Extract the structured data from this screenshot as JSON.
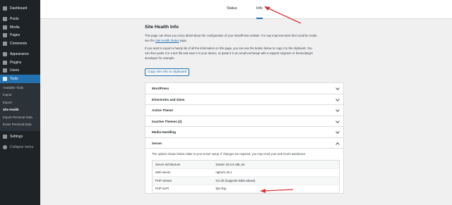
{
  "sidebar": {
    "items": [
      {
        "label": "Dashboard",
        "icon": "dashboard-icon"
      },
      {
        "label": "Posts",
        "icon": "pin-icon"
      },
      {
        "label": "Media",
        "icon": "media-icon"
      },
      {
        "label": "Pages",
        "icon": "page-icon"
      },
      {
        "label": "Comments",
        "icon": "comment-icon"
      },
      {
        "label": "Appearance",
        "icon": "brush-icon"
      },
      {
        "label": "Plugins",
        "icon": "plugin-icon"
      },
      {
        "label": "Users",
        "icon": "users-icon"
      },
      {
        "label": "Tools",
        "icon": "wrench-icon"
      }
    ],
    "submenu": [
      "Available Tools",
      "Import",
      "Export",
      "Site Health",
      "Export Personal Data",
      "Erase Personal Data"
    ],
    "after": [
      {
        "label": "Settings",
        "icon": "settings-icon"
      },
      {
        "label": "Collapse menu",
        "icon": "collapse-icon"
      }
    ]
  },
  "header": {
    "tabs": [
      "Status",
      "Info"
    ],
    "active_tab": "Info"
  },
  "main": {
    "title": "Site Health Info",
    "desc1": "This page can show you every detail about the configuration of your WordPress website. For any improvements that could be made,",
    "desc1b_pre": "see the ",
    "desc1b_link": "Site Health Status",
    "desc1b_post": " page.",
    "desc2a": "If you want to export a handy list of all the information on this page, you can use the button below to copy it to the clipboard. You",
    "desc2b": "can then paste it in a text file and save it to your device, or paste it in an email exchange with a support engineer or theme/plugin",
    "desc2c": "developer for example.",
    "copy_button": "Copy site info to clipboard"
  },
  "accordion": {
    "sections": [
      "WordPress",
      "Directories and Sizes",
      "Active Theme",
      "Inactive Themes (2)",
      "Media Handling",
      "Server"
    ],
    "server_desc": "The options shown below relate to your server setup. If changes are required, you may need your web host's assistance.",
    "rows": [
      {
        "key": "Server architecture",
        "value": "Darwin 19.6.0 x86_64"
      },
      {
        "key": "Web server",
        "value": "nginx/1.19.1"
      },
      {
        "key": "PHP version",
        "value": "8.0.30 (Supports 64bit values)"
      },
      {
        "key": "PHP SAPI",
        "value": "fpm-fcgi"
      }
    ]
  },
  "colors": {
    "sidebar": "#1d2327",
    "accent": "#2271b1",
    "arrow": "#d63638"
  }
}
